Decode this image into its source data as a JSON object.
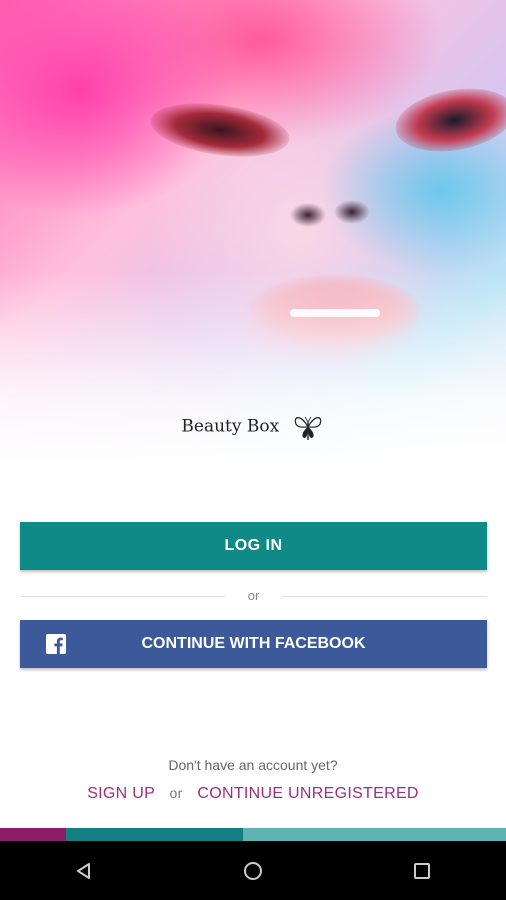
{
  "brand": {
    "name": "Beauty Box"
  },
  "buttons": {
    "login": "LOG IN",
    "facebook": "CONTINUE WITH FACEBOOK"
  },
  "divider_text": "or",
  "footer": {
    "prompt": "Don't have an account yet?",
    "signup": "SIGN UP",
    "or": "or",
    "unregistered": "CONTINUE UNREGISTERED"
  },
  "colors": {
    "login": "#0f8a87",
    "facebook": "#3c5a99",
    "link": "#9a2f7f",
    "stripe": [
      "#8a1f68",
      "#137f82",
      "#5fb3b3"
    ]
  },
  "icons": {
    "facebook": "facebook-icon",
    "logo": "butterfly-icon",
    "nav": [
      "back-icon",
      "home-icon",
      "recents-icon"
    ]
  }
}
